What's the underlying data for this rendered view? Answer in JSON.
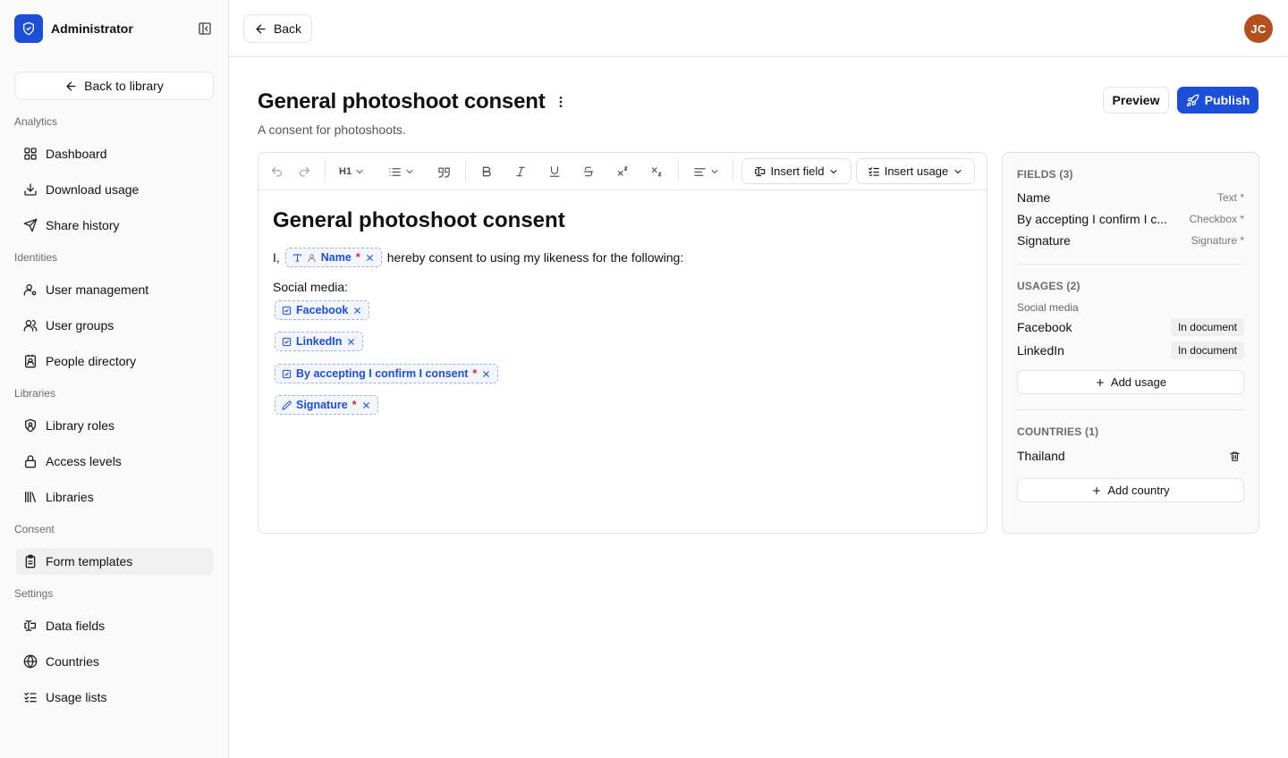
{
  "sidebar": {
    "app_name": "Administrator",
    "back_to_library": "Back to library",
    "groups": [
      {
        "label": "Analytics",
        "items": [
          {
            "label": "Dashboard",
            "icon": "grid-icon"
          },
          {
            "label": "Download usage",
            "icon": "download-icon"
          },
          {
            "label": "Share history",
            "icon": "send-icon"
          }
        ]
      },
      {
        "label": "Identities",
        "items": [
          {
            "label": "User management",
            "icon": "user-icon"
          },
          {
            "label": "User groups",
            "icon": "users-icon"
          },
          {
            "label": "People directory",
            "icon": "contact-icon"
          }
        ]
      },
      {
        "label": "Libraries",
        "items": [
          {
            "label": "Library roles",
            "icon": "shield-icon"
          },
          {
            "label": "Access levels",
            "icon": "lock-icon"
          },
          {
            "label": "Libraries",
            "icon": "library-icon"
          }
        ]
      },
      {
        "label": "Consent",
        "items": [
          {
            "label": "Form templates",
            "icon": "clipboard-icon",
            "active": true
          }
        ]
      },
      {
        "label": "Settings",
        "items": [
          {
            "label": "Data fields",
            "icon": "field-icon"
          },
          {
            "label": "Countries",
            "icon": "globe-icon"
          },
          {
            "label": "Usage lists",
            "icon": "list-checks-icon"
          }
        ]
      }
    ]
  },
  "topbar": {
    "back": "Back",
    "avatar_initials": "JC"
  },
  "page": {
    "title": "General photoshoot consent",
    "subtitle": "A consent for photoshoots.",
    "preview": "Preview",
    "publish": "Publish"
  },
  "toolbar": {
    "heading": "H1",
    "insert_field": "Insert field",
    "insert_usage": "Insert usage"
  },
  "document": {
    "heading": "General photoshoot consent",
    "line1_prefix": "I,",
    "line1_suffix": "hereby consent to using my likeness for the following:",
    "social_label": "Social media:",
    "chips": {
      "name": "Name",
      "facebook": "Facebook",
      "linkedin": "LinkedIn",
      "consent": "By accepting I confirm I consent",
      "signature": "Signature",
      "required_mark": "*"
    }
  },
  "panel": {
    "fields_title": "FIELDS (3)",
    "fields": [
      {
        "name": "Name",
        "type": "Text *"
      },
      {
        "name": "By accepting I confirm I c...",
        "type": "Checkbox *"
      },
      {
        "name": "Signature",
        "type": "Signature *"
      }
    ],
    "usages_title": "USAGES (2)",
    "usages_group": "Social media",
    "usages": [
      {
        "name": "Facebook",
        "badge": "In document"
      },
      {
        "name": "LinkedIn",
        "badge": "In document"
      }
    ],
    "add_usage": "Add usage",
    "countries_title": "COUNTRIES (1)",
    "countries": [
      {
        "name": "Thailand"
      }
    ],
    "add_country": "Add country"
  },
  "colors": {
    "accent": "#1d4ed8",
    "avatar": "#b4501e",
    "required": "#dc2626"
  }
}
